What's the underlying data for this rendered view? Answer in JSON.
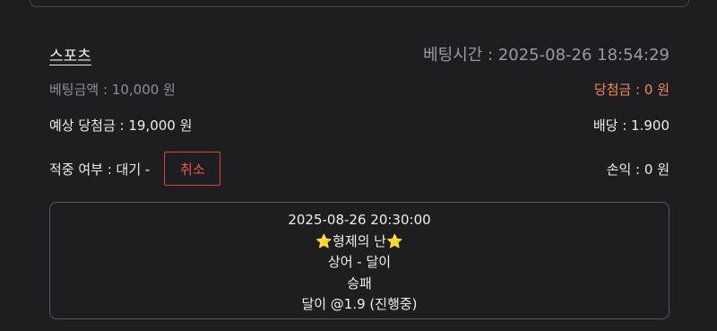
{
  "sport": {
    "title": "스포츠"
  },
  "bet": {
    "time_label": "베팅시간 : 2025-08-26 18:54:29",
    "amount_label": "베팅금액 : 10,000 원",
    "win_amount_label": "당첨금 : 0 원",
    "expected_win_label": "예상 당첨금 : 19,000 원",
    "odds_label": "배당 : 1.900",
    "hit_status_label": "적중 여부 : 대기 -",
    "profit_label": "손익 : 0 원",
    "cancel_label": "취소"
  },
  "detail": {
    "datetime": "2025-08-26 20:30:00",
    "league_star_left": "⭐",
    "league_name": "형제의 난",
    "league_star_right": "⭐",
    "matchup": "상어 - 달이",
    "market": "승패",
    "selection": "달이 @1.9 (진행중)"
  },
  "colors": {
    "background": "#1e1e21",
    "accent_win": "#f08a5d",
    "cancel_border": "#d9443a",
    "star": "#f5c518"
  }
}
